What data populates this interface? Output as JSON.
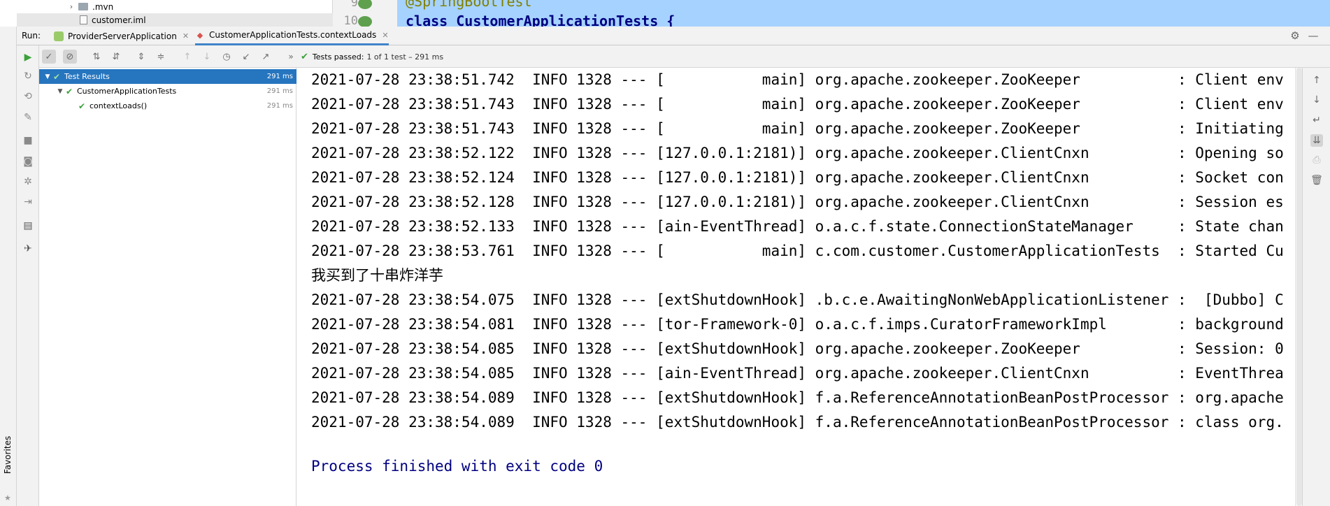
{
  "project_tree": {
    "items": [
      {
        "label": ".mvn",
        "icon": "folder-icon"
      },
      {
        "label": "customer.iml",
        "icon": "file-icon"
      }
    ]
  },
  "editor": {
    "gutter": [
      "9",
      "10"
    ],
    "code": [
      "@SpringBootTest",
      "class CustomerApplicationTests {"
    ]
  },
  "run": {
    "label": "Run:",
    "tabs": [
      {
        "label": "ProviderServerApplication",
        "icon": "spring-boot-icon"
      },
      {
        "label": "CustomerApplicationTests.contextLoads",
        "icon": "junit-icon"
      }
    ]
  },
  "favorites": {
    "label": "Favorites"
  },
  "status": {
    "passed": "Tests passed: ",
    "rest": "1 of 1 test – 291 ms"
  },
  "test_tree": [
    {
      "label": "Test Results",
      "duration": "291 ms"
    },
    {
      "label": "CustomerApplicationTests",
      "duration": "291 ms"
    },
    {
      "label": "contextLoads()",
      "duration": "291 ms"
    }
  ],
  "console": {
    "lines": [
      "2021-07-28 23:38:51.742  INFO 1328 --- [           main] org.apache.zookeeper.ZooKeeper           : Client env",
      "2021-07-28 23:38:51.743  INFO 1328 --- [           main] org.apache.zookeeper.ZooKeeper           : Client env",
      "2021-07-28 23:38:51.743  INFO 1328 --- [           main] org.apache.zookeeper.ZooKeeper           : Initiating",
      "2021-07-28 23:38:52.122  INFO 1328 --- [127.0.0.1:2181)] org.apache.zookeeper.ClientCnxn          : Opening so",
      "2021-07-28 23:38:52.124  INFO 1328 --- [127.0.0.1:2181)] org.apache.zookeeper.ClientCnxn          : Socket con",
      "2021-07-28 23:38:52.128  INFO 1328 --- [127.0.0.1:2181)] org.apache.zookeeper.ClientCnxn          : Session es",
      "2021-07-28 23:38:52.133  INFO 1328 --- [ain-EventThread] o.a.c.f.state.ConnectionStateManager     : State chan",
      "2021-07-28 23:38:53.761  INFO 1328 --- [           main] c.com.customer.CustomerApplicationTests  : Started Cu",
      "我买到了十串炸洋芋",
      "2021-07-28 23:38:54.075  INFO 1328 --- [extShutdownHook] .b.c.e.AwaitingNonWebApplicationListener :  [Dubbo] C",
      "2021-07-28 23:38:54.081  INFO 1328 --- [tor-Framework-0] o.a.c.f.imps.CuratorFrameworkImpl        : background",
      "2021-07-28 23:38:54.085  INFO 1328 --- [extShutdownHook] org.apache.zookeeper.ZooKeeper           : Session: 0",
      "2021-07-28 23:38:54.085  INFO 1328 --- [ain-EventThread] org.apache.zookeeper.ClientCnxn          : EventThrea",
      "2021-07-28 23:38:54.089  INFO 1328 --- [extShutdownHook] f.a.ReferenceAnnotationBeanPostProcessor : org.apache",
      "2021-07-28 23:38:54.089  INFO 1328 --- [extShutdownHook] f.a.ReferenceAnnotationBeanPostProcessor : class org."
    ],
    "exit_message": "Process finished with exit code 0"
  }
}
